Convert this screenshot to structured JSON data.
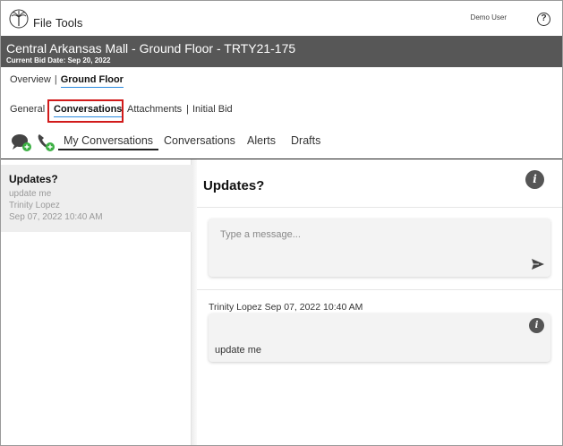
{
  "menu": {
    "file": "File",
    "tools": "Tools"
  },
  "user": {
    "name": "Demo User",
    "help": "?"
  },
  "header": {
    "title": "Central Arkansas Mall - Ground Floor - TRTY21-175",
    "subtitle": "Current Bid Date: Sep 20, 2022"
  },
  "breadcrumb": {
    "overview": "Overview",
    "separator": "|",
    "current": "Ground Floor"
  },
  "sections": {
    "general": "General",
    "conversations": "Conversations",
    "attachments": "Attachments",
    "separator": "|",
    "initial_bid": "Initial Bid"
  },
  "conv_tabs": {
    "my_conversations": "My Conversations",
    "conversations": "Conversations",
    "alerts": "Alerts",
    "drafts": "Drafts"
  },
  "list": {
    "items": [
      {
        "title": "Updates?",
        "preview": "update me",
        "author": "Trinity Lopez",
        "date": "Sep 07, 2022 10:40 AM"
      }
    ]
  },
  "detail": {
    "title": "Updates?",
    "info_glyph": "i",
    "compose_placeholder": "Type a message...",
    "message": {
      "meta": "Trinity Lopez  Sep 07, 2022 10:40 AM",
      "text": "update me"
    }
  },
  "icons": {
    "logo": "palm-logo-icon",
    "chat": "chat-bubble-add-icon",
    "phone": "phone-add-icon",
    "send": "send-icon",
    "info": "info-icon",
    "help": "help-icon"
  },
  "colors": {
    "band": "#575757",
    "accent": "#2a8be0",
    "highlight": "#d11a1a",
    "badge_green": "#3cb043"
  }
}
